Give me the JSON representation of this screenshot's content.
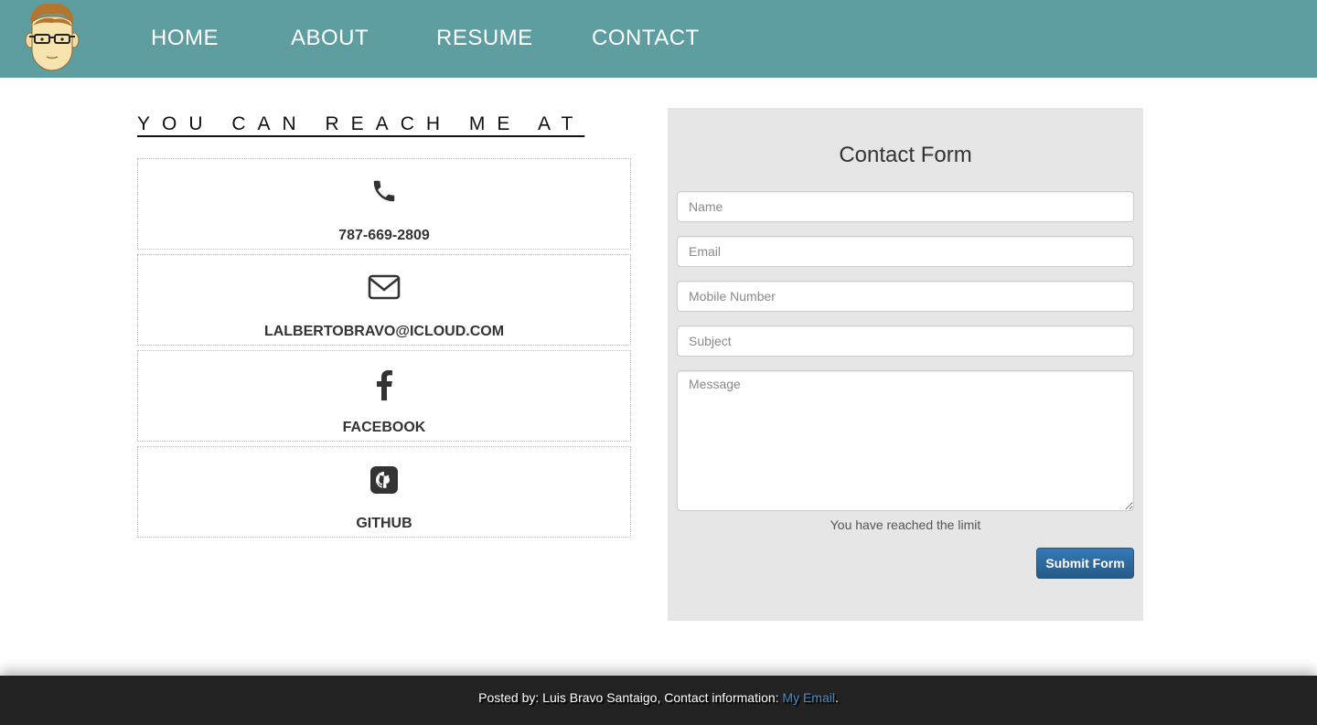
{
  "nav": {
    "items": [
      {
        "label": "HOME"
      },
      {
        "label": "ABOUT"
      },
      {
        "label": "RESUME"
      },
      {
        "label": "CONTACT"
      }
    ],
    "background": "#5f9ea0"
  },
  "reach": {
    "heading": "YOU CAN REACH ME AT",
    "cards": [
      {
        "icon": "phone-icon",
        "label": "787-669-2809"
      },
      {
        "icon": "envelope-icon",
        "label": "LALBERTOBRAVO@ICLOUD.COM"
      },
      {
        "icon": "facebook-icon",
        "label": "FACEBOOK"
      },
      {
        "icon": "github-icon",
        "label": "GITHUB"
      }
    ]
  },
  "form": {
    "title": "Contact Form",
    "name_placeholder": "Name",
    "email_placeholder": "Email",
    "mobile_placeholder": "Mobile Number",
    "subject_placeholder": "Subject",
    "message_placeholder": "Message",
    "limit_text": "You have reached the limit",
    "submit_label": "Submit Form",
    "panel_color": "#e6e6e6",
    "button_color": "#337ab7"
  },
  "footer": {
    "prefix": "Posted by: Luis Bravo Santaigo, Contact information: ",
    "link_label": "My Email",
    "suffix": ".",
    "background": "#222222",
    "link_color": "#428bca"
  }
}
